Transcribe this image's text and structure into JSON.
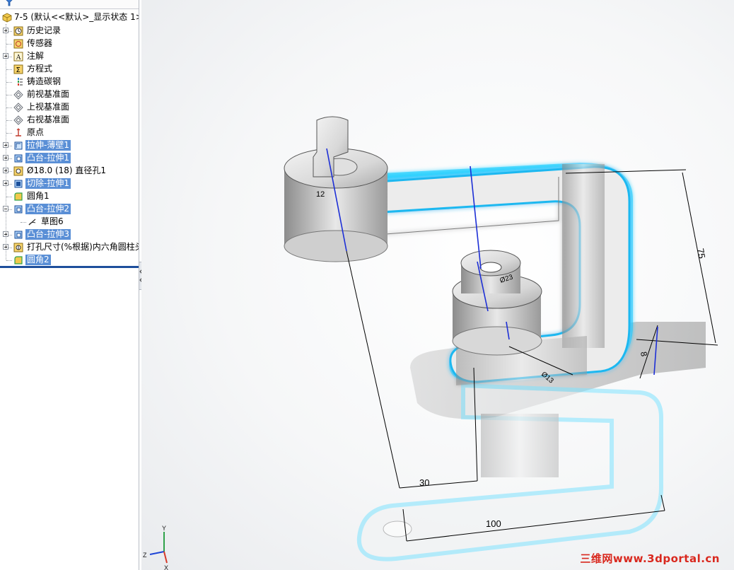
{
  "feature_tree": {
    "root_label": "7-5 (默认<<默认>_显示状态 1>",
    "items": [
      {
        "label": "历史记录",
        "icon": "history-icon",
        "expander": "plus",
        "selected": false
      },
      {
        "label": "传感器",
        "icon": "sensor-icon",
        "expander": "none",
        "selected": false
      },
      {
        "label": "注解",
        "icon": "annotation-icon",
        "expander": "plus",
        "selected": false
      },
      {
        "label": "方程式",
        "icon": "equation-icon",
        "expander": "none",
        "selected": false
      },
      {
        "label": "铸造碳钢",
        "icon": "material-icon",
        "expander": "none",
        "selected": false
      },
      {
        "label": "前视基准面",
        "icon": "plane-icon",
        "expander": "none",
        "selected": false
      },
      {
        "label": "上视基准面",
        "icon": "plane-icon",
        "expander": "none",
        "selected": false
      },
      {
        "label": "右视基准面",
        "icon": "plane-icon",
        "expander": "none",
        "selected": false
      },
      {
        "label": "原点",
        "icon": "origin-icon",
        "expander": "none",
        "selected": false
      },
      {
        "label": "拉伸-薄壁1",
        "icon": "extrude-icon",
        "expander": "plus",
        "selected": true
      },
      {
        "label": "凸台-拉伸1",
        "icon": "boss-extrude-icon",
        "expander": "plus",
        "selected": true
      },
      {
        "label": "Ø18.0 (18) 直径孔1",
        "icon": "hole-icon",
        "expander": "plus",
        "selected": false
      },
      {
        "label": "切除-拉伸1",
        "icon": "cut-extrude-icon",
        "expander": "plus",
        "selected": true
      },
      {
        "label": "圆角1",
        "icon": "fillet-icon",
        "expander": "none",
        "selected": false
      },
      {
        "label": "凸台-拉伸2",
        "icon": "boss-extrude-icon",
        "expander": "minus",
        "selected": true
      },
      {
        "label": "草图6",
        "icon": "sketch-icon",
        "expander": "none",
        "selected": false,
        "child": true
      },
      {
        "label": "凸台-拉伸3",
        "icon": "boss-extrude-icon",
        "expander": "plus",
        "selected": true
      },
      {
        "label": "打孔尺寸(%根据)内六角圆柱头",
        "icon": "hole-wizard-icon",
        "expander": "plus",
        "selected": false
      },
      {
        "label": "圆角2",
        "icon": "fillet-icon",
        "expander": "none",
        "selected": true
      }
    ]
  },
  "viewport": {
    "dimensions": {
      "d1": "12",
      "d2": "75",
      "d3": "Ø23",
      "d4": "Ø13",
      "d5": "8",
      "d6": "30",
      "d7": "100"
    },
    "triad": {
      "y": "Y",
      "z": "Z",
      "x": "X"
    },
    "accent_highlight": "#00c8ff"
  },
  "watermark": "三维网www.3dportal.cn"
}
